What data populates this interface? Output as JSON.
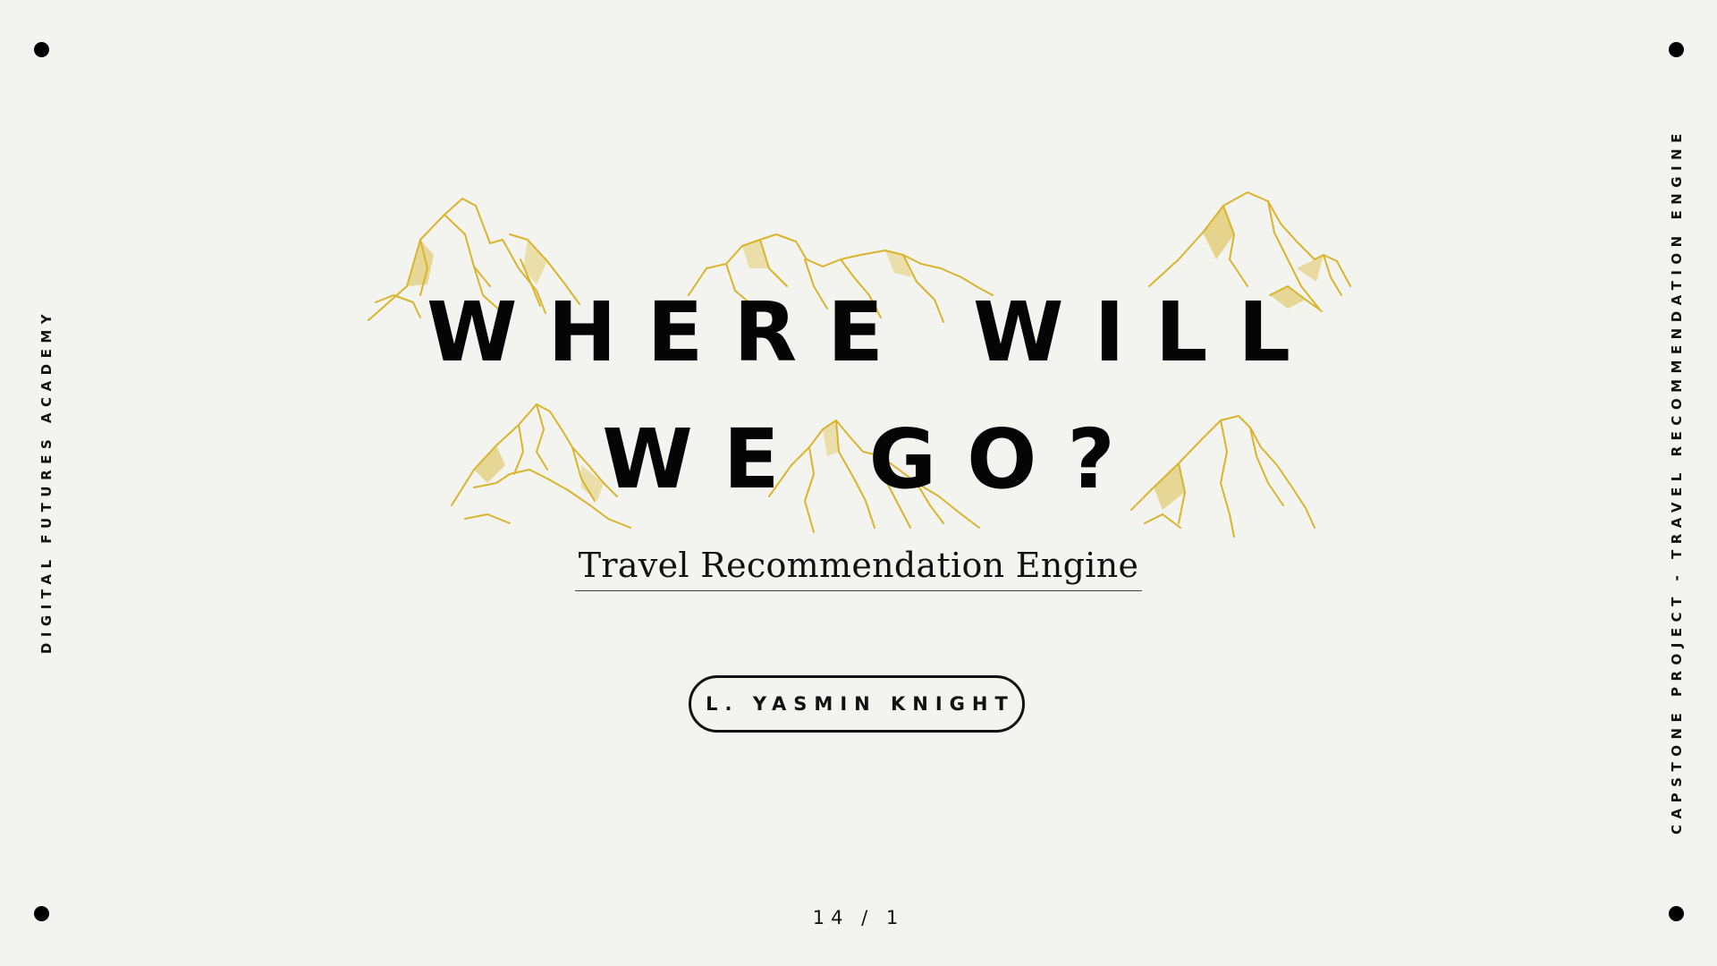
{
  "slide": {
    "title_line_1": "WHERE WILL",
    "title_line_2": "WE GO?",
    "subtitle": "Travel Recommendation Engine",
    "author": "L. YASMIN KNIGHT",
    "left_side_text": "DIGITAL FUTURES ACADEMY",
    "right_side_text": "CAPSTONE PROJECT - TRAVEL RECOMMENDATION ENGINE",
    "page_counter": "14 / 1"
  },
  "colors": {
    "background": "#f3f4ef",
    "text": "#050505",
    "mountain_gold": "#d9b42c"
  },
  "decorations": {
    "corner_icon": "dot-icon",
    "mountain_icon": "mountain-illustration-icon"
  }
}
